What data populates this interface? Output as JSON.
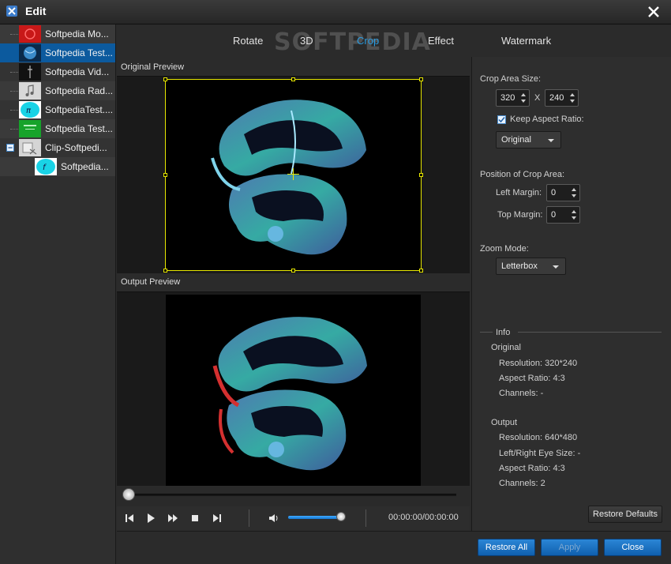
{
  "window": {
    "title": "Edit",
    "watermark": "SOFTPEDIA"
  },
  "files": [
    {
      "label": "Softpedia Mo...",
      "thumb": "red-thumb",
      "selected": false
    },
    {
      "label": "Softpedia Test...",
      "thumb": "blue-globe-thumb",
      "selected": true
    },
    {
      "label": "Softpedia Vid...",
      "thumb": "dark-thumb",
      "selected": false
    },
    {
      "label": "Softpedia Rad...",
      "thumb": "music-note-thumb",
      "selected": false
    },
    {
      "label": "SoftpediaTest....",
      "thumb": "cyan-thumb",
      "selected": false
    },
    {
      "label": "Softpedia Test...",
      "thumb": "green-thumb",
      "selected": false
    },
    {
      "label": "Clip-Softpedi...",
      "thumb": "clip-thumb",
      "selected": false,
      "expand": "−"
    },
    {
      "label": "Softpedia...",
      "thumb": "cyan-thumb",
      "selected": false,
      "child": true
    }
  ],
  "tabs": [
    {
      "label": "Rotate",
      "active": false
    },
    {
      "label": "3D",
      "active": false
    },
    {
      "label": "Crop",
      "active": true
    },
    {
      "label": "Effect",
      "active": false
    },
    {
      "label": "Watermark",
      "active": false
    }
  ],
  "preview": {
    "original_label": "Original Preview",
    "output_label": "Output Preview"
  },
  "player": {
    "timecode": "00:00:00/00:00:00",
    "progress": 0.0,
    "volume": 0.85
  },
  "crop": {
    "area_size_label": "Crop Area Size:",
    "width": "320",
    "separator": "X",
    "height": "240",
    "keep_aspect_label": "Keep Aspect Ratio:",
    "keep_aspect_checked": true,
    "aspect_option": "Original",
    "position_label": "Position of Crop Area:",
    "left_margin_label": "Left Margin:",
    "left_margin": "0",
    "top_margin_label": "Top Margin:",
    "top_margin": "0",
    "zoom_label": "Zoom Mode:",
    "zoom_option": "Letterbox"
  },
  "info": {
    "heading": "Info",
    "original_heading": "Original",
    "original_resolution": "Resolution: 320*240",
    "original_aspect": "Aspect Ratio: 4:3",
    "original_channels": "Channels: -",
    "output_heading": "Output",
    "output_resolution": "Resolution: 640*480",
    "output_eye_size": "Left/Right Eye Size: -",
    "output_aspect": "Aspect Ratio: 4:3",
    "output_channels": "Channels: 2"
  },
  "buttons": {
    "restore_defaults": "Restore Defaults",
    "restore_all": "Restore All",
    "apply": "Apply",
    "close": "Close"
  }
}
